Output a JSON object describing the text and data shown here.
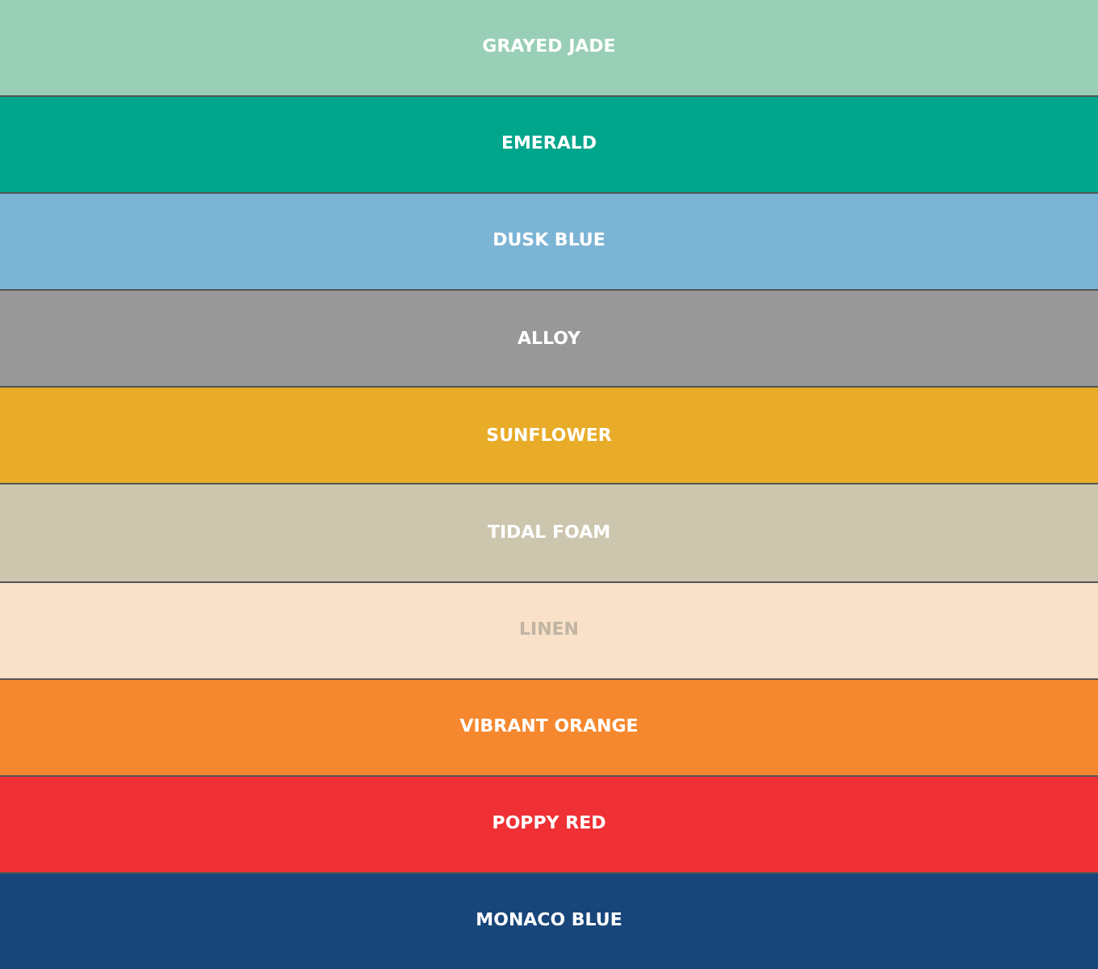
{
  "swatches": [
    {
      "name": "GRAYED JADE",
      "color": "#98cfb6"
    },
    {
      "name": "EMERALD",
      "color": "#00a68c"
    },
    {
      "name": "DUSK BLUE",
      "color": "#7bb4d5"
    },
    {
      "name": "ALLOY",
      "color": "#989898"
    },
    {
      "name": "SUNFLOWER",
      "color": "#e8ac28"
    },
    {
      "name": "TIDAL FOAM",
      "color": "#cdc6ae"
    },
    {
      "name": "LINEN",
      "color": "#f8e1c8"
    },
    {
      "name": "VIBRANT ORANGE",
      "color": "#f5882e"
    },
    {
      "name": "POPPY RED",
      "color": "#ef3035"
    },
    {
      "name": "MONACO BLUE",
      "color": "#18467a"
    }
  ]
}
